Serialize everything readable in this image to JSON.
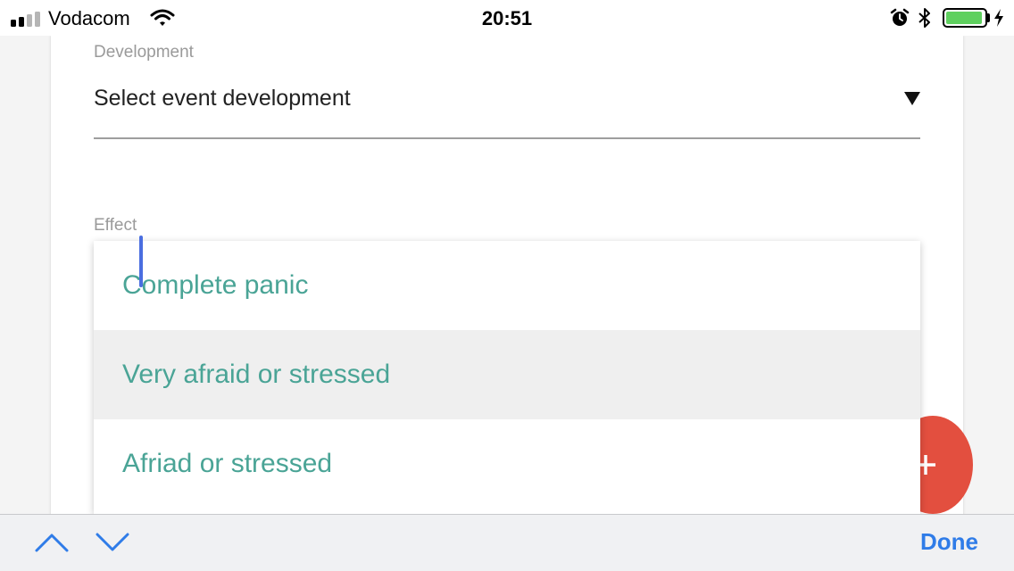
{
  "status_bar": {
    "carrier": "Vodacom",
    "time": "20:51",
    "signal_bars_filled": 2,
    "signal_bars_total": 4,
    "battery_level": 0.95,
    "icons": [
      "signal-icon",
      "wifi-icon",
      "alarm-icon",
      "bluetooth-icon",
      "battery-icon",
      "charging-icon"
    ]
  },
  "form": {
    "development": {
      "label": "Development",
      "value": "Select event development"
    },
    "effect": {
      "label": "Effect",
      "options": [
        "Complete panic",
        "Very afraid or stressed",
        "Afriad or stressed"
      ],
      "highlighted_index": 1
    }
  },
  "fab": {
    "icon": "plus-icon"
  },
  "keyboard_toolbar": {
    "done_label": "Done",
    "prev_icon": "chevron-up-icon",
    "next_icon": "chevron-down-icon"
  },
  "colors": {
    "option_text": "#4aa496",
    "highlight_bg": "#efefef",
    "fab": "#e34f3f",
    "accent_blue": "#2f7ce8",
    "cursor": "#4a6ee0",
    "battery": "#5fd05f"
  }
}
